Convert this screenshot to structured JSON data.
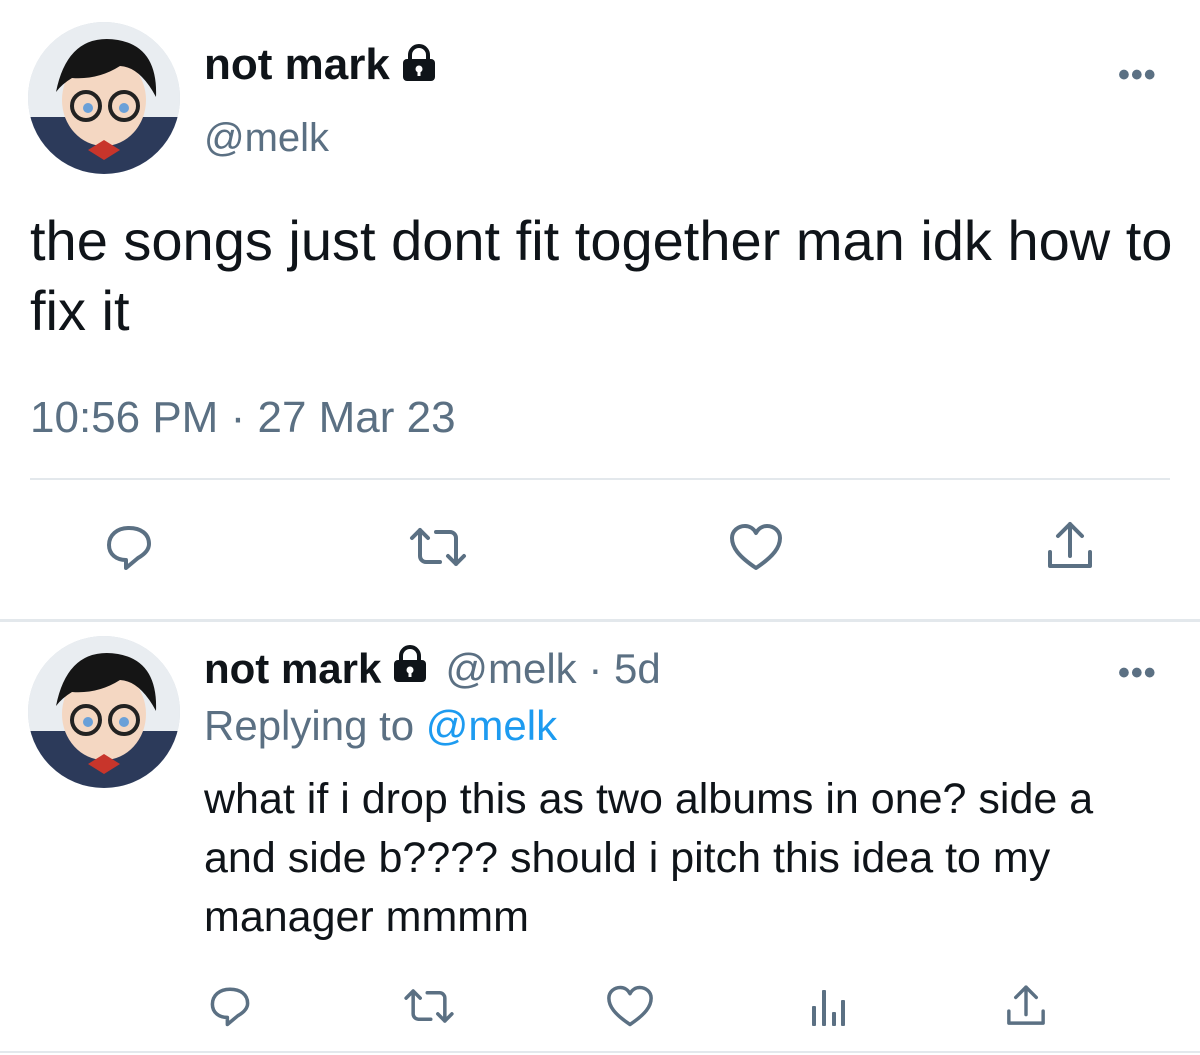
{
  "main_tweet": {
    "display_name": "not mark",
    "handle": "@melk",
    "text": "the songs just dont fit together man idk how to fix it",
    "time": "10:56 PM",
    "date": "27 Mar 23",
    "more_label": "•••"
  },
  "reply_tweet": {
    "display_name": "not mark",
    "handle": "@melk",
    "age": "5d",
    "replying_prefix": "Replying to",
    "replying_to": "@melk",
    "text": "what if i drop this as two albums in one? side a and side b???? should i pitch this idea to my manager mmmm",
    "more_label": "•••"
  },
  "icons": {
    "reply": "reply-icon",
    "retweet": "retweet-icon",
    "like": "heart-icon",
    "analytics": "analytics-icon",
    "share": "share-icon",
    "lock": "lock-icon"
  },
  "colors": {
    "text": "#0f1419",
    "secondary": "#5b7083",
    "link": "#1d9bf0",
    "divider": "#e3e8ec"
  }
}
